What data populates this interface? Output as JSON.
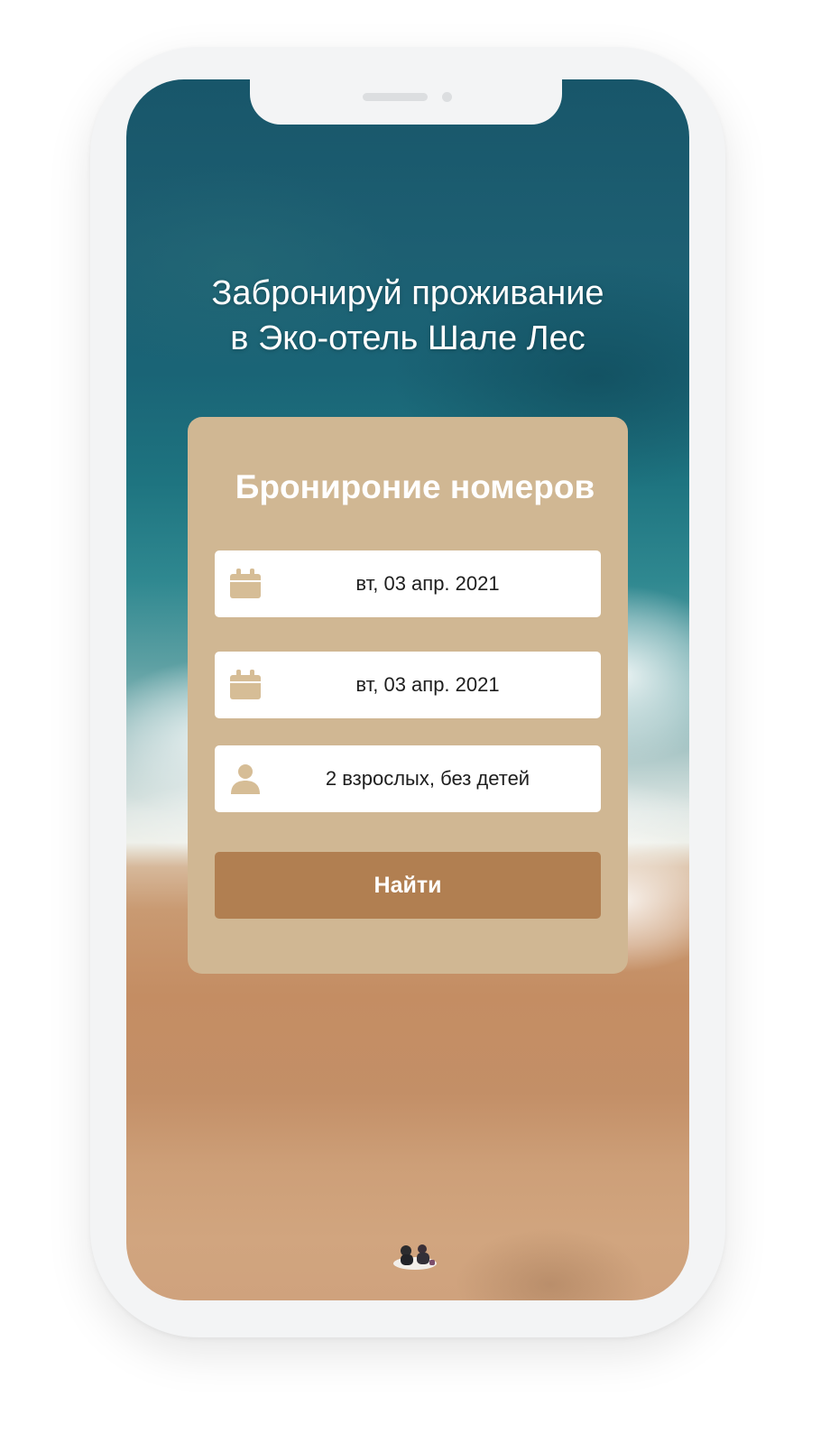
{
  "hero": {
    "title_line1": "Забронируй проживание",
    "title_line2": "в Эко-отель Шале Лес"
  },
  "booking": {
    "title": "Бронироние номеров",
    "checkin_date": "вт, 03 апр. 2021",
    "checkout_date": "вт, 03 апр. 2021",
    "guests": "2 взрослых, без детей",
    "search_label": "Найти"
  },
  "icons": {
    "checkin": "calendar-icon",
    "checkout": "calendar-icon",
    "guests": "user-icon"
  },
  "colors": {
    "card": "#d0b793",
    "button": "#b17f51",
    "icon": "#d6bd96",
    "sea": "#1a6476",
    "sand": "#c48d63"
  }
}
